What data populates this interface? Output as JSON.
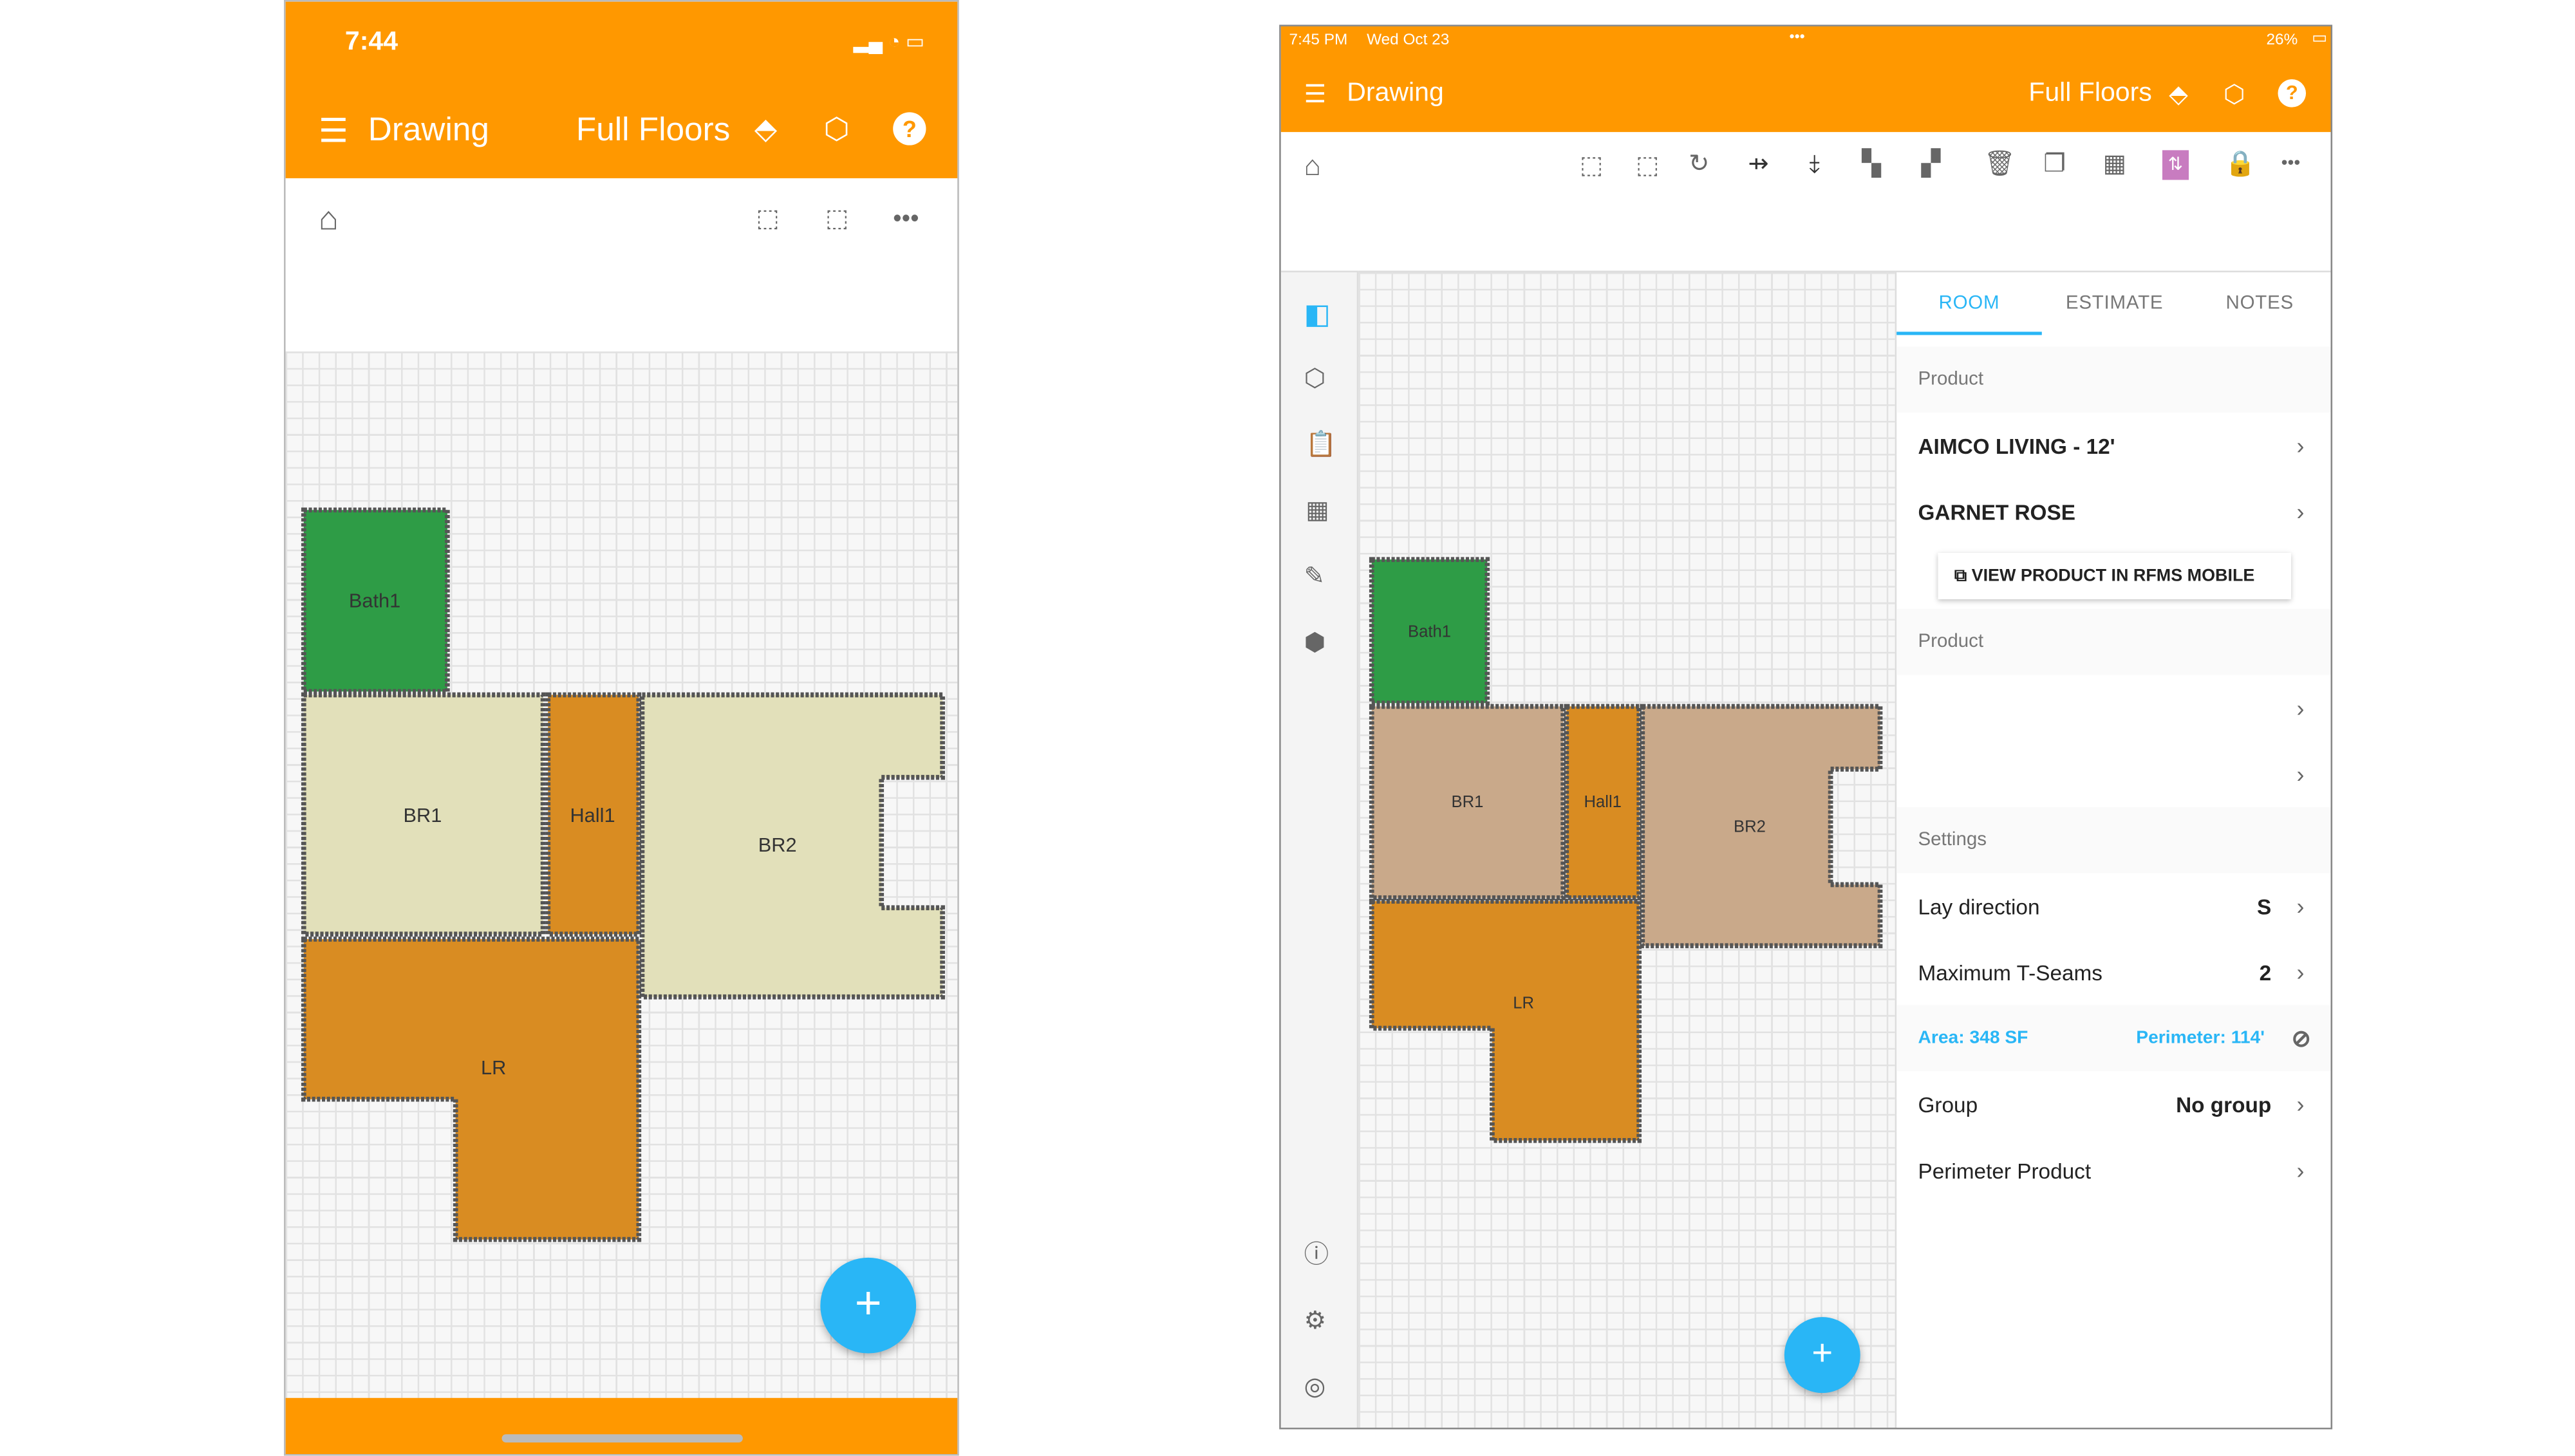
{
  "phone": {
    "time": "7:44",
    "menu_title": "Drawing",
    "brand": "Full Floors",
    "rooms": [
      {
        "name": "Bath1"
      },
      {
        "name": "BR1"
      },
      {
        "name": "Hall1"
      },
      {
        "name": "BR2"
      },
      {
        "name": "LR"
      }
    ],
    "fab": "+"
  },
  "tablet": {
    "time": "7:45 PM",
    "date": "Wed Oct 23",
    "battery": "26%",
    "menu_title": "Drawing",
    "brand": "Full Floors",
    "fab": "+",
    "rooms": [
      {
        "name": "Bath1"
      },
      {
        "name": "BR1"
      },
      {
        "name": "Hall1"
      },
      {
        "name": "BR2"
      },
      {
        "name": "LR"
      }
    ],
    "panel": {
      "tabs": [
        "ROOM",
        "ESTIMATE",
        "NOTES"
      ],
      "product_header": "Product",
      "product_name": "AIMCO LIVING - 12'",
      "product_color": "GARNET ROSE",
      "view_button": "VIEW PRODUCT IN RFMS MOBILE",
      "product_header2": "Product",
      "settings_header": "Settings",
      "lay_direction_label": "Lay direction",
      "lay_direction_value": "S",
      "tseams_label": "Maximum T-Seams",
      "tseams_value": "2",
      "area_label": "Area:",
      "area_value": "348 SF",
      "perimeter_label": "Perimeter:",
      "perimeter_value": "114'",
      "group_label": "Group",
      "group_value": "No group",
      "perimeter_product_label": "Perimeter Product"
    }
  },
  "colors": {
    "accent": "#ff9800",
    "fab": "#29b6f6",
    "bath": "#2e9c46",
    "room_light": "#e2e0ba",
    "room_orange": "#d98c22",
    "room_tan": "#c9a98a"
  }
}
